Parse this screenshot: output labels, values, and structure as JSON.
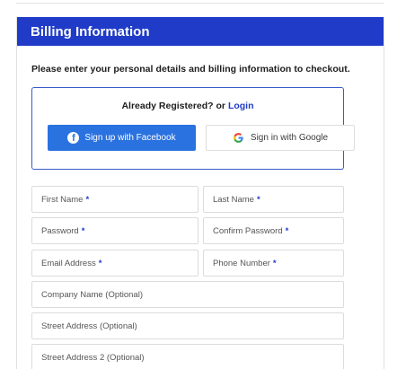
{
  "header": {
    "title": "Billing Information"
  },
  "intro_text": "Please enter your personal details and billing information to checkout.",
  "social": {
    "already_registered": "Already Registered? or",
    "login_label": "Login",
    "facebook_label": "Sign up with Facebook",
    "google_label": "Sign in with Google"
  },
  "fields": {
    "first_name": {
      "label": "First Name",
      "required": "*"
    },
    "last_name": {
      "label": "Last Name",
      "required": "*"
    },
    "password": {
      "label": "Password",
      "required": "*"
    },
    "confirm_password": {
      "label": "Confirm Password",
      "required": "*"
    },
    "email": {
      "label": "Email Address",
      "required": "*"
    },
    "phone": {
      "label": "Phone Number",
      "required": "*"
    },
    "company": {
      "label": "Company Name (Optional)"
    },
    "street": {
      "label": "Street Address (Optional)"
    },
    "street2": {
      "label": "Street Address 2 (Optional)"
    }
  },
  "colors": {
    "header_bg": "#1f3bc8",
    "facebook_button": "#2a72e0",
    "required_marker": "#1f3bc8"
  }
}
